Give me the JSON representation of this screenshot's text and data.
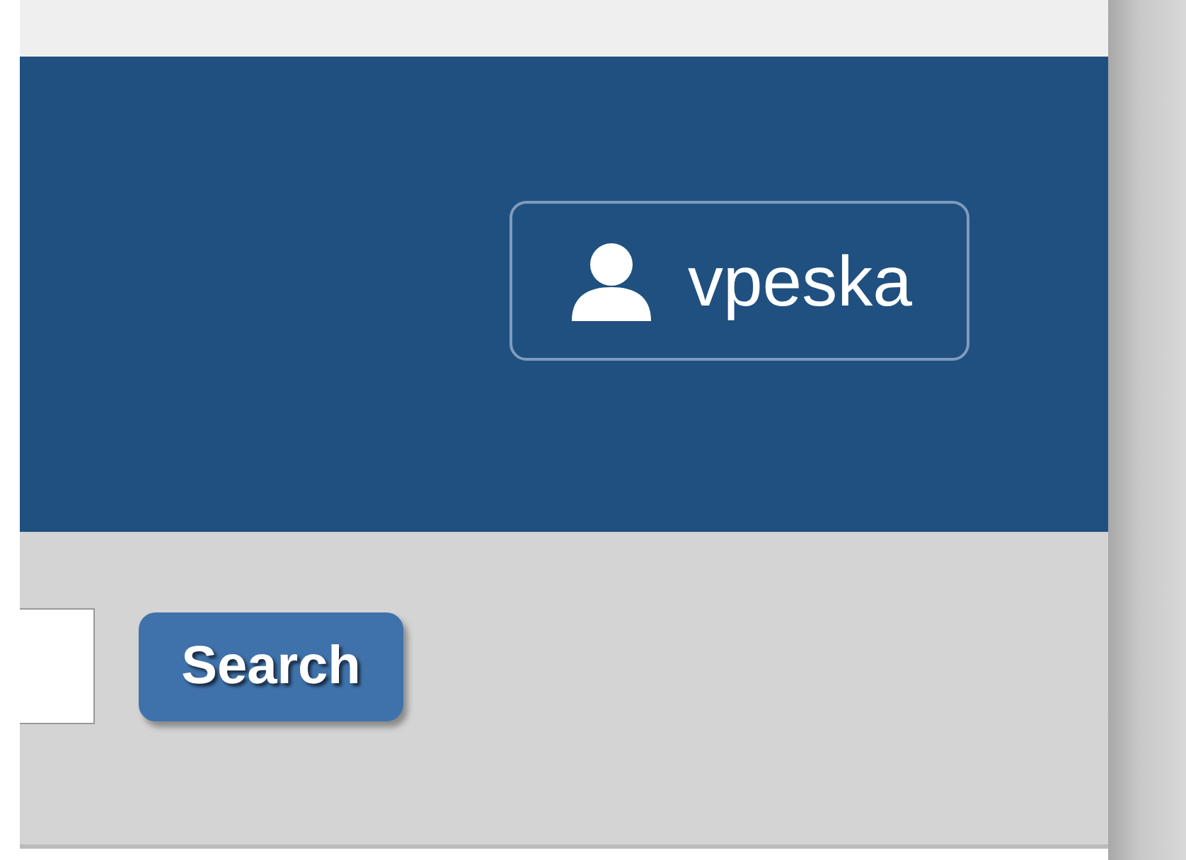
{
  "header": {
    "user_button": {
      "label": "vpeska"
    }
  },
  "search_bar": {
    "button": "Search"
  }
}
